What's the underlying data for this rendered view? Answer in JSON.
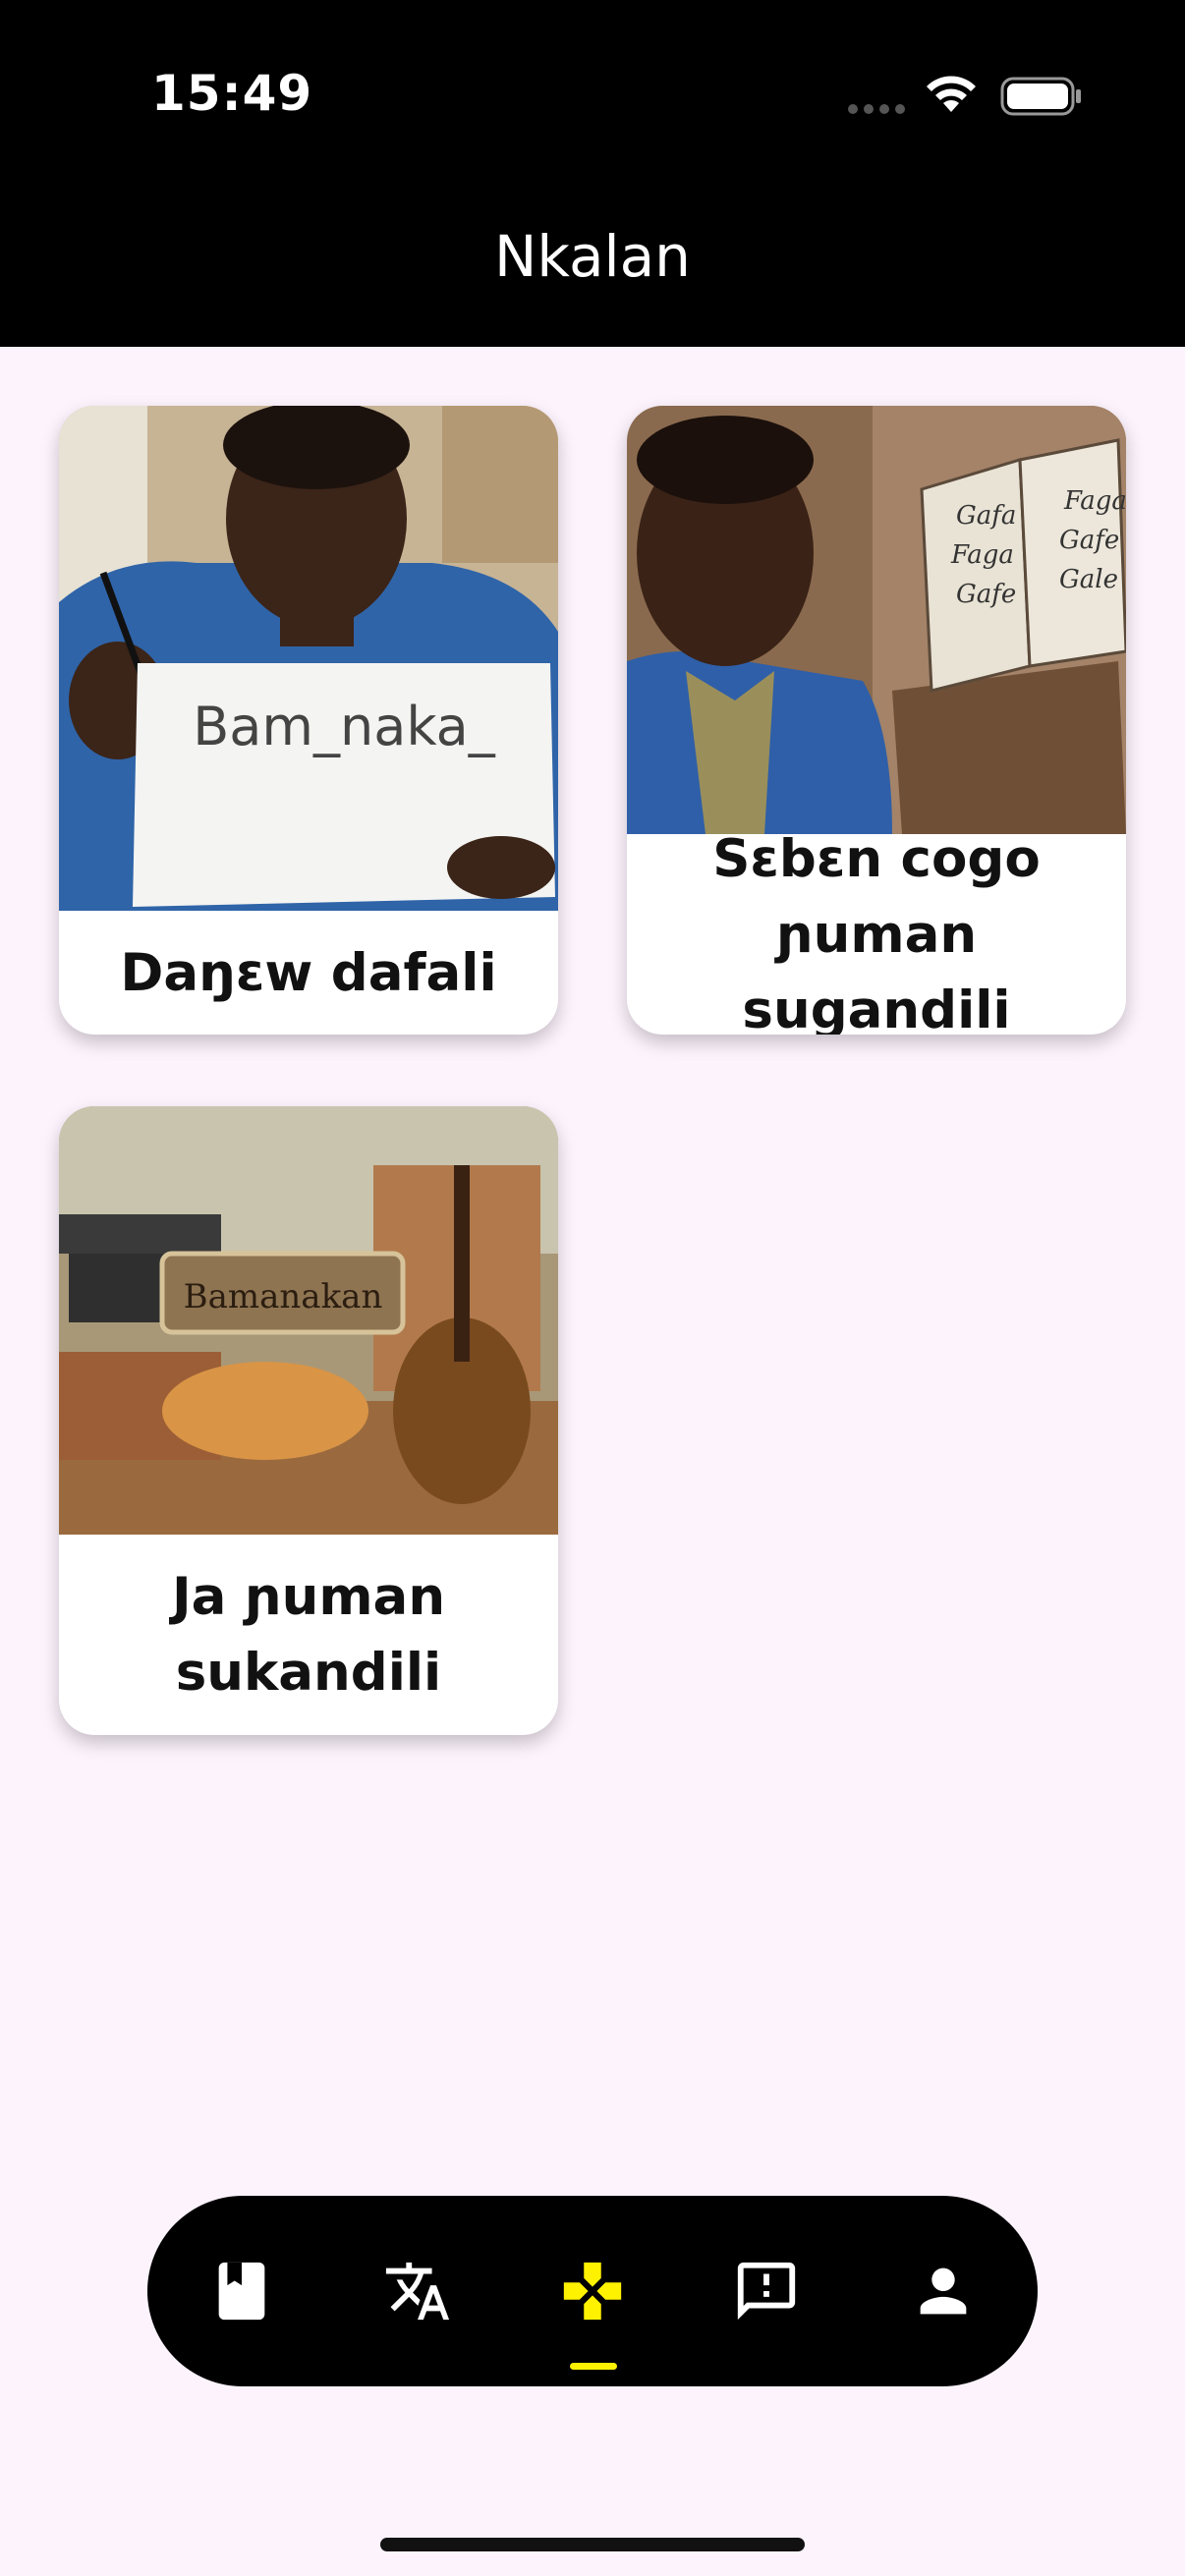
{
  "status_bar": {
    "time": "15:49"
  },
  "header": {
    "title": "Nkalan"
  },
  "cards": [
    {
      "label": "Daŋɛw dafali",
      "image_text": "Bam_naka_"
    },
    {
      "label": "Sɛbɛn cogo ɲuman sugandili",
      "image_text": [
        "Gafa",
        "Faga",
        "Gafe",
        "Faga",
        "Gafe",
        "Gale"
      ]
    },
    {
      "label": "Ja ɲuman sukandili",
      "image_text": "Bamanakan"
    }
  ],
  "bottom_nav": {
    "items": [
      {
        "icon": "book-icon",
        "active": false
      },
      {
        "icon": "translate-icon",
        "active": false
      },
      {
        "icon": "gamepad-icon",
        "active": true
      },
      {
        "icon": "feedback-icon",
        "active": false
      },
      {
        "icon": "person-icon",
        "active": false
      }
    ],
    "active_color": "#fff200",
    "inactive_color": "#ffffff"
  },
  "colors": {
    "background": "#fdf3fd",
    "header_background": "#000000",
    "nav_background": "#000000"
  }
}
